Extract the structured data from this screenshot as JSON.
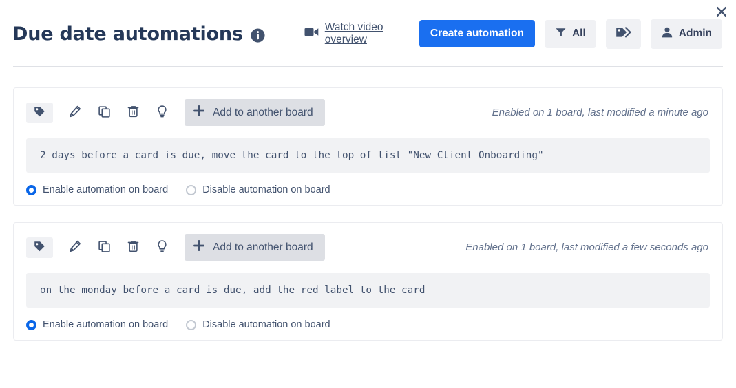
{
  "window": {
    "close_label": "✕"
  },
  "header": {
    "title": "Due date automations",
    "info_icon": "info-icon",
    "watch_video": {
      "label": "Watch video overview",
      "icon": "video-camera-icon"
    },
    "create_automation": "Create automation",
    "filter": {
      "label": "All",
      "icon": "filter-icon"
    },
    "labels_button": {
      "icon": "tags-icon"
    },
    "account": {
      "label": "Admin",
      "icon": "person-icon"
    }
  },
  "toolbar_icons": {
    "tag": "tag-icon",
    "edit": "pencil-icon",
    "copy": "copy-icon",
    "delete": "trash-icon",
    "tips": "lightbulb-icon",
    "add_board": "plus-icon"
  },
  "common": {
    "add_to_another_board": "Add to another board",
    "enable_label": "Enable automation on board",
    "disable_label": "Disable automation on board"
  },
  "colors": {
    "primary": "#1a6ff0",
    "radio_selected": "#0a66e8",
    "icon": "#42526e",
    "card_border": "#ebecf0",
    "rule_bg": "#f1f2f4"
  },
  "automations": [
    {
      "status": "Enabled on 1 board, last modified a minute ago",
      "rule": "2 days before a card is due, move the card to the top of list \"New Client Onboarding\"",
      "enabled_selected": true
    },
    {
      "status": "Enabled on 1 board, last modified a few seconds ago",
      "rule": "on the monday before a card is due, add the red label to the card",
      "enabled_selected": true
    }
  ]
}
